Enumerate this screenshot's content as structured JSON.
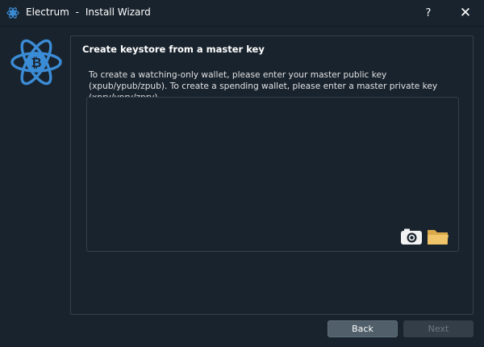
{
  "window": {
    "app_name": "Electrum",
    "separator": "-",
    "title": "Install Wizard",
    "help_glyph": "?",
    "close_glyph": "✕",
    "icons": [
      "electrum-logo-icon",
      "help-icon",
      "close-icon"
    ]
  },
  "page": {
    "heading": "Create keystore from a master key",
    "instructions": "To create a watching-only wallet, please enter your master public key (xpub/ypub/zpub). To create a spending wallet, please enter a master private key (xprv/yprv/zprv).",
    "key_input_value": "",
    "key_input_icons": [
      "camera-icon",
      "folder-icon"
    ]
  },
  "buttons": {
    "back": "Back",
    "next": "Next",
    "next_enabled": false
  },
  "colors": {
    "background": "#19232d",
    "border": "#32414b",
    "accent_blue": "#3b8cd6",
    "folder": "#f0c56a"
  }
}
